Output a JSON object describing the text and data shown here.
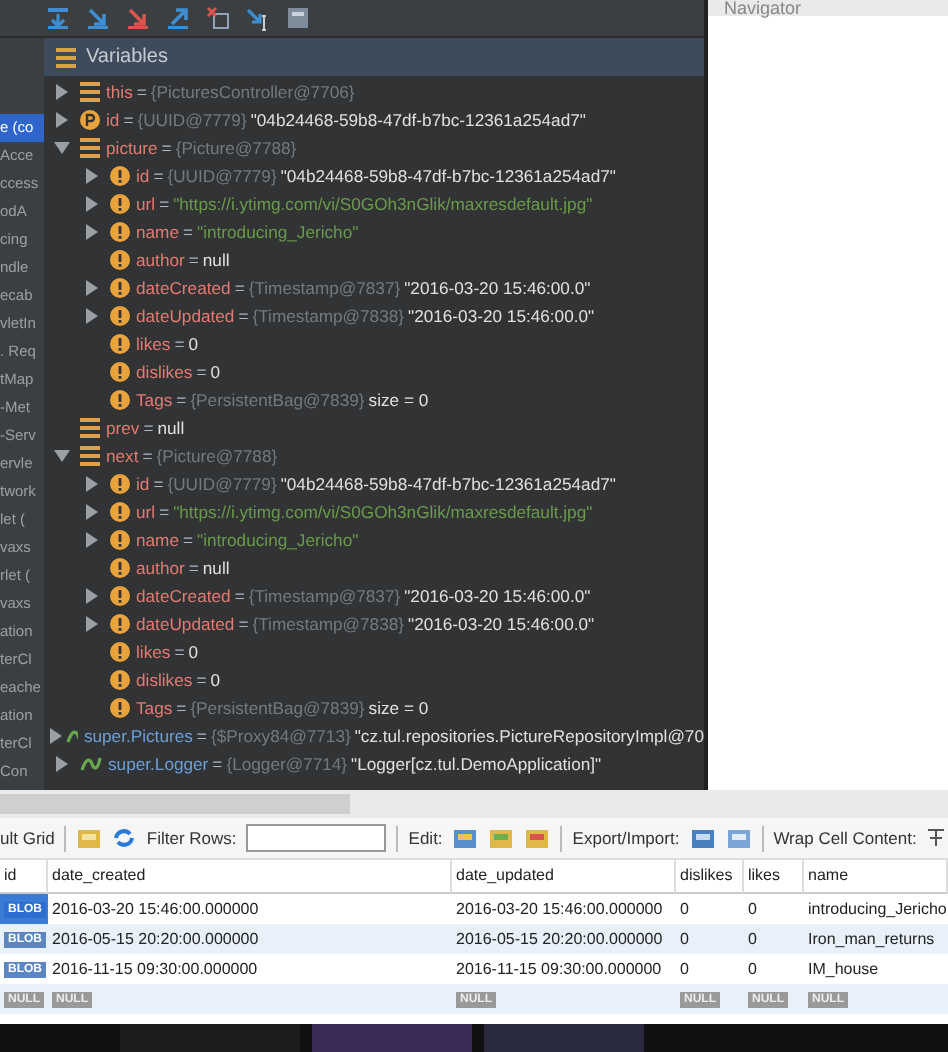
{
  "frames": [
    {
      "label": "e (co",
      "selected": true
    },
    {
      "label": "Acce",
      "selected": false
    },
    {
      "label": "ccess",
      "selected": false
    },
    {
      "label": "odA",
      "selected": false
    },
    {
      "label": "cing",
      "selected": false
    },
    {
      "label": "ndle",
      "selected": false
    },
    {
      "label": "ecab",
      "selected": false
    },
    {
      "label": "vletIn",
      "selected": false
    },
    {
      "label": ". Req",
      "selected": false
    },
    {
      "label": "tMap",
      "selected": false
    },
    {
      "label": "-Met",
      "selected": false
    },
    {
      "label": "-Serv",
      "selected": false
    },
    {
      "label": "ervle",
      "selected": false
    },
    {
      "label": "twork",
      "selected": false
    },
    {
      "label": "let (",
      "selected": false
    },
    {
      "label": "vaxs",
      "selected": false
    },
    {
      "label": "rlet (",
      "selected": false
    },
    {
      "label": "vaxs",
      "selected": false
    },
    {
      "label": "ation",
      "selected": false
    },
    {
      "label": "terCl",
      "selected": false
    },
    {
      "label": "eache",
      "selected": false
    },
    {
      "label": "ation",
      "selected": false
    },
    {
      "label": "terCl",
      "selected": false
    },
    {
      "label": "Con",
      "selected": false
    }
  ],
  "variables_panel": {
    "title": "Variables",
    "items": [
      {
        "kind": "field",
        "name": "this",
        "eq": "=",
        "type": "{PicturesController@7706}",
        "expanded": false
      },
      {
        "kind": "primitive",
        "name": "id",
        "eq": "=",
        "type": "{UUID@7779}",
        "value": "\"04b24468-59b8-47df-b7bc-12361a254ad7\"",
        "string": false,
        "expanded": false
      },
      {
        "kind": "field",
        "name": "picture",
        "eq": "=",
        "type": "{Picture@7788}",
        "expanded": true,
        "children": [
          {
            "kind": "private",
            "name": "id",
            "eq": "=",
            "type": "{UUID@7779}",
            "value": "\"04b24468-59b8-47df-b7bc-12361a254ad7\"",
            "string": false,
            "expanded": false
          },
          {
            "kind": "private",
            "name": "url",
            "eq": "=",
            "value": "\"https://i.ytimg.com/vi/S0GOh3nGlik/maxresdefault.jpg\"",
            "string": true,
            "expanded": false
          },
          {
            "kind": "private",
            "name": "name",
            "eq": "=",
            "value": "\"introducing_Jericho\"",
            "string": true,
            "expanded": false
          },
          {
            "kind": "private",
            "name": "author",
            "eq": "=",
            "value": "null",
            "string": false
          },
          {
            "kind": "private",
            "name": "dateCreated",
            "eq": "=",
            "type": "{Timestamp@7837}",
            "value": "\"2016-03-20 15:46:00.0\"",
            "string": false,
            "expanded": false
          },
          {
            "kind": "private",
            "name": "dateUpdated",
            "eq": "=",
            "type": "{Timestamp@7838}",
            "value": "\"2016-03-20 15:46:00.0\"",
            "string": false,
            "expanded": false
          },
          {
            "kind": "private",
            "name": "likes",
            "eq": "=",
            "value": "0",
            "string": false
          },
          {
            "kind": "private",
            "name": "dislikes",
            "eq": "=",
            "value": "0",
            "string": false
          },
          {
            "kind": "private",
            "name": "Tags",
            "eq": "=",
            "type": "{PersistentBag@7839}",
            "value": "size = 0",
            "string": false
          }
        ]
      },
      {
        "kind": "field",
        "name": "prev",
        "eq": "=",
        "value": "null",
        "string": false
      },
      {
        "kind": "field",
        "name": "next",
        "eq": "=",
        "type": "{Picture@7788}",
        "expanded": true,
        "children": [
          {
            "kind": "private",
            "name": "id",
            "eq": "=",
            "type": "{UUID@7779}",
            "value": "\"04b24468-59b8-47df-b7bc-12361a254ad7\"",
            "string": false,
            "expanded": false
          },
          {
            "kind": "private",
            "name": "url",
            "eq": "=",
            "value": "\"https://i.ytimg.com/vi/S0GOh3nGlik/maxresdefault.jpg\"",
            "string": true,
            "expanded": false
          },
          {
            "kind": "private",
            "name": "name",
            "eq": "=",
            "value": "\"introducing_Jericho\"",
            "string": true,
            "expanded": false
          },
          {
            "kind": "private",
            "name": "author",
            "eq": "=",
            "value": "null",
            "string": false
          },
          {
            "kind": "private",
            "name": "dateCreated",
            "eq": "=",
            "type": "{Timestamp@7837}",
            "value": "\"2016-03-20 15:46:00.0\"",
            "string": false,
            "expanded": false
          },
          {
            "kind": "private",
            "name": "dateUpdated",
            "eq": "=",
            "type": "{Timestamp@7838}",
            "value": "\"2016-03-20 15:46:00.0\"",
            "string": false,
            "expanded": false
          },
          {
            "kind": "private",
            "name": "likes",
            "eq": "=",
            "value": "0",
            "string": false
          },
          {
            "kind": "private",
            "name": "dislikes",
            "eq": "=",
            "value": "0",
            "string": false
          },
          {
            "kind": "private",
            "name": "Tags",
            "eq": "=",
            "type": "{PersistentBag@7839}",
            "value": "size = 0",
            "string": false
          }
        ]
      },
      {
        "kind": "inherited",
        "name": "super.Pictures",
        "eq": "=",
        "type": "{$Proxy84@7713}",
        "value": "\"cz.tul.repositories.PictureRepositoryImpl@70",
        "string": false,
        "expanded": false
      },
      {
        "kind": "inherited",
        "name": "super.Logger",
        "eq": "=",
        "type": "{Logger@7714}",
        "value": "\"Logger[cz.tul.DemoApplication]\"",
        "string": false,
        "expanded": false
      }
    ]
  },
  "navigator": {
    "title": "Navigator"
  },
  "result_toolbar": {
    "grid_label": "ult Grid",
    "filter_label": "Filter Rows:",
    "edit_label": "Edit:",
    "export_label": "Export/Import:",
    "wrap_label": "Wrap Cell Content:"
  },
  "table": {
    "columns": [
      "id",
      "date_created",
      "date_updated",
      "dislikes",
      "likes",
      "name"
    ],
    "rows": [
      {
        "selected": true,
        "cells": [
          "BLOB",
          "2016-03-20 15:46:00.000000",
          "2016-03-20 15:46:00.000000",
          "0",
          "0",
          "introducing_Jericho"
        ]
      },
      {
        "selected": false,
        "cells": [
          "BLOB",
          "2016-05-15 20:20:00.000000",
          "2016-05-15 20:20:00.000000",
          "0",
          "0",
          "Iron_man_returns"
        ]
      },
      {
        "selected": false,
        "cells": [
          "BLOB",
          "2016-11-15 09:30:00.000000",
          "2016-11-15 09:30:00.000000",
          "0",
          "0",
          "IM_house"
        ]
      },
      {
        "selected": false,
        "cells": [
          "NULL",
          "NULL",
          "NULL",
          "NULL",
          "NULL",
          "NULL"
        ]
      }
    ]
  }
}
